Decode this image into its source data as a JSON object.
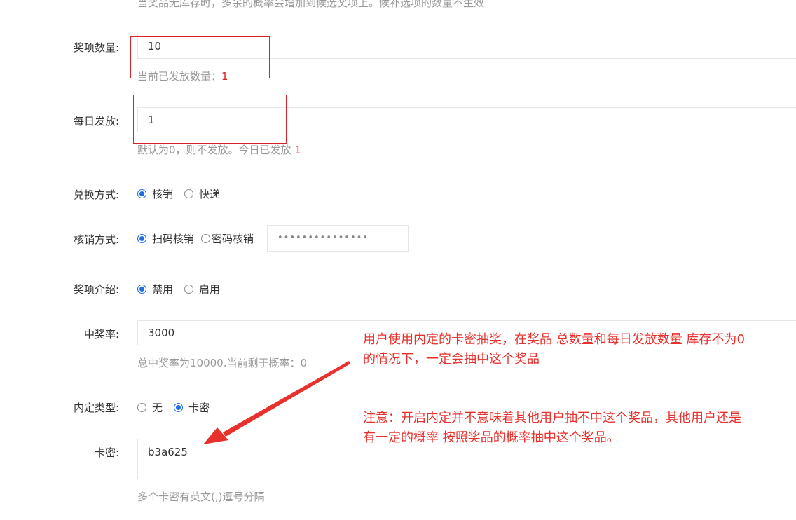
{
  "top_hint": "当奖品无库存时，多余的概率会增加到候选奖项上。候补选项的数量不生效",
  "prize_count": {
    "label": "奖项数量:",
    "value": "10",
    "hint_prefix": "当前已发放数量：",
    "hint_value": "1"
  },
  "daily_issue": {
    "label": "每日发放:",
    "value": "1",
    "hint_prefix": "默认为0，则不发放。今日已发放 ",
    "hint_value": "1"
  },
  "redeem_method": {
    "label": "兑换方式:",
    "options": [
      "核销",
      "快递"
    ],
    "selected": "核销"
  },
  "verify_method": {
    "label": "核销方式:",
    "options": [
      "扫码核销",
      "密码核销"
    ],
    "selected": "扫码核销",
    "password_mask": "•••••••••••••••"
  },
  "prize_intro": {
    "label": "奖项介绍:",
    "options": [
      "禁用",
      "启用"
    ],
    "selected": "禁用"
  },
  "win_rate": {
    "label": "中奖率:",
    "value": "3000",
    "hint": "总中奖率为10000.当前剩于概率：0"
  },
  "internal_type": {
    "label": "内定类型:",
    "options": [
      "无",
      "卡密"
    ],
    "selected": "卡密"
  },
  "card_key": {
    "label": "卡密:",
    "value": "b3a625",
    "hint": "多个卡密有英文(,)逗号分隔"
  },
  "annotations": {
    "note1_line1": "用户使用内定的卡密抽奖，在奖品 总数量和每日发放数量 库存不为0",
    "note1_line2": "的情况下，一定会抽中这个奖品",
    "note2_line1": "注意：开启内定并不意味着其他用户抽不中这个奖品，其他用户还是",
    "note2_line2": "有一定的概率 按照奖品的概率抽中这个奖品。"
  },
  "colors": {
    "accent_blue": "#1e6fe0",
    "annotation_red": "#e8302d",
    "hint_gray": "#999999"
  }
}
